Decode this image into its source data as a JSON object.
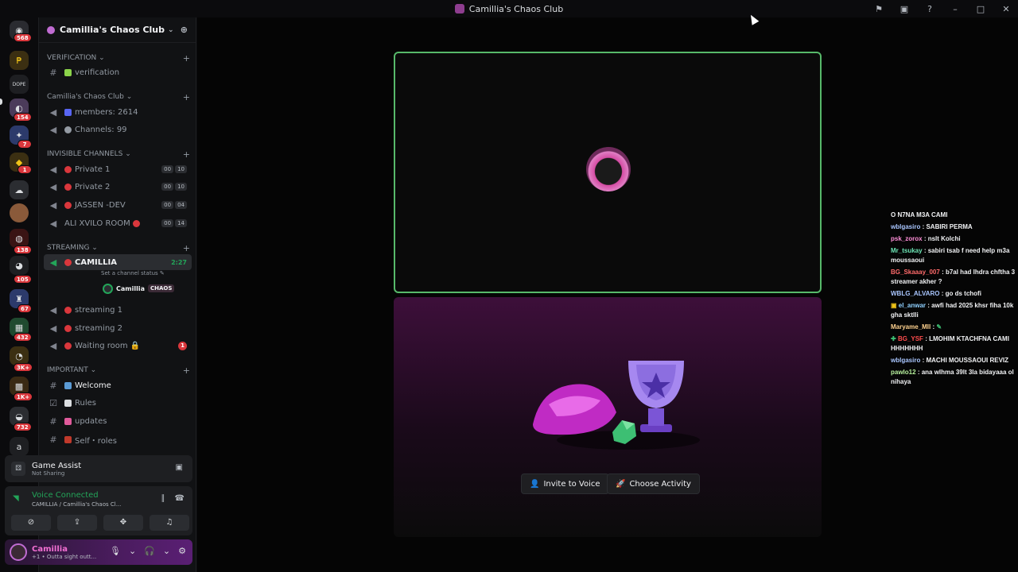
{
  "window": {
    "title": "Camillia's Chaos Club"
  },
  "server_rail": {
    "badges": [
      "568",
      "154",
      "7",
      "1",
      "138",
      "105",
      "67",
      "432",
      "3K+",
      "1K+",
      "732"
    ],
    "label_a": "a"
  },
  "server": {
    "name": "Camillia's Chaos Club"
  },
  "categories": {
    "verification": "VERIFICATION",
    "club": "Camillia's Chaos Club",
    "invisible": "INVISIBLE CHANNELS",
    "streaming": "STREAMING",
    "important": "IMPORTANT"
  },
  "channels": {
    "verification": "verification",
    "members": "members: 2614",
    "channels_count": "Channels: 99",
    "private1": {
      "label": "Private 1",
      "a": "00",
      "b": "10"
    },
    "private2": {
      "label": "Private 2",
      "a": "00",
      "b": "10"
    },
    "jassen": {
      "label": "JASSEN -DEV",
      "a": "00",
      "b": "04"
    },
    "ali": {
      "label": "ALI XVILO ROOM",
      "a": "00",
      "b": "14"
    },
    "camillia": {
      "label": "CAMILLIA",
      "timer": "2:27",
      "status_hint": "Set a channel status"
    },
    "voice_user": {
      "name": "Camillia",
      "tag": "CHAOS"
    },
    "streaming1": "streaming 1",
    "streaming2": "streaming 2",
    "waiting": {
      "label": "Waiting room",
      "badge": "1"
    },
    "welcome": "Welcome",
    "rules": "Rules",
    "updates": "updates",
    "self_roles": "Self・roles"
  },
  "game_assist": {
    "title": "Game Assist",
    "subtitle": "Not Sharing"
  },
  "voice": {
    "title": "Voice Connected",
    "subtitle": "CAMILLIA / Camillia's Chaos Cl..."
  },
  "user": {
    "name": "Camillia",
    "status": "+1 • Outta sight outt..."
  },
  "activity": {
    "invite_label": "Invite to Voice",
    "choose_label": "Choose Activity"
  },
  "chat": [
    {
      "name": "",
      "text": "O N7NA M3A CAMI",
      "color": "#f2f3f5"
    },
    {
      "name": "wblgasiro",
      "text": ": SABIRI PERMA",
      "color": "#a9c6ff"
    },
    {
      "name": "psk_zorox",
      "text": ": nslt Kolchi",
      "color": "#ff8fd8"
    },
    {
      "name": "Mr_tsukay",
      "text": ": sabiri tsab f need help m3a moussaoui",
      "color": "#6ee7b7"
    },
    {
      "name": "BG_Skaaay_007",
      "text": ": b7al had lhdra chftha 3 streamer akher ?",
      "color": "#ff6b6b"
    },
    {
      "name": "WBLG_ALVARO",
      "text": ": go ds tchofi",
      "color": "#a9c6ff"
    },
    {
      "name": "el_anwar",
      "text": ": awfi had 2025 khsr fiha 10k gha sktlli",
      "color": "#8fd0ff"
    },
    {
      "name": "Maryame_Mll",
      "text": ":",
      "color": "#ffd28f"
    },
    {
      "name": "BG_YSF",
      "text": ": LMOHIM KTACHFNA CAMI HHHHHHH",
      "color": "#ff4d4d"
    },
    {
      "name": "wblgasiro",
      "text": ": MACHI MOUSSAOUI REVIZ",
      "color": "#a9c6ff"
    },
    {
      "name": "pawlo12",
      "text": ": ana wlhma 39lt 3la bidayaaa ol nihaya",
      "color": "#b6f09c"
    }
  ]
}
